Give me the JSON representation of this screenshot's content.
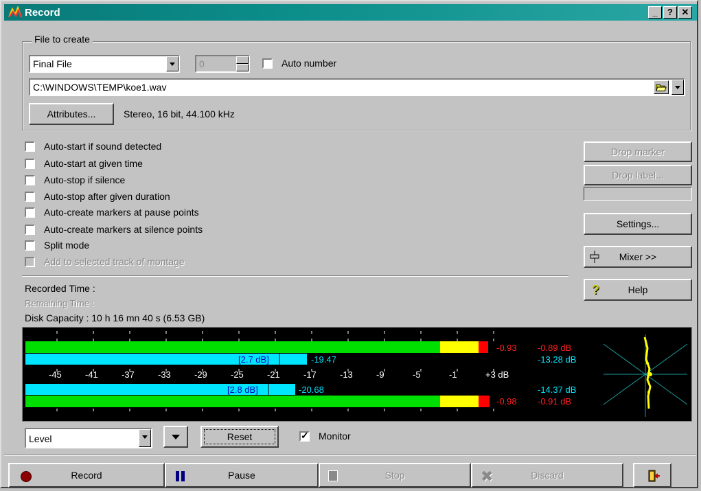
{
  "window": {
    "title": "Record",
    "buttons": {
      "minimize": "_",
      "help": "?",
      "close": "✕"
    }
  },
  "file_group": {
    "legend": "File to create",
    "type_value": "Final File",
    "number_value": "0",
    "auto_number_label": "Auto number",
    "path": "C:\\WINDOWS\\TEMP\\koe1.wav",
    "attributes_button": "Attributes...",
    "format": "Stereo, 16 bit, 44.100 kHz"
  },
  "options": [
    {
      "label": "Auto-start if sound detected",
      "checked": false,
      "enabled": true
    },
    {
      "label": "Auto-start at given time",
      "checked": false,
      "enabled": true
    },
    {
      "label": "Auto-stop if silence",
      "checked": false,
      "enabled": true
    },
    {
      "label": "Auto-stop after given duration",
      "checked": false,
      "enabled": true
    },
    {
      "label": "Auto-create markers at pause points",
      "checked": false,
      "enabled": true
    },
    {
      "label": "Auto-create markers at silence points",
      "checked": false,
      "enabled": true
    },
    {
      "label": "Split mode",
      "checked": false,
      "enabled": true
    },
    {
      "label": "Add to selected track of montage",
      "checked": false,
      "enabled": false
    }
  ],
  "side_buttons": {
    "drop_marker": "Drop marker",
    "drop_label": "Drop label...",
    "settings": "Settings...",
    "mixer": "Mixer >>",
    "help": "Help"
  },
  "status": {
    "recorded_time": "Recorded Time :",
    "remaining_time": "Remaining Time :",
    "disk_capacity": "Disk Capacity : 10 h 16 mn 40 s (6.53 GB)"
  },
  "meter": {
    "scale": [
      "-45",
      "-41",
      "-37",
      "-33",
      "-29",
      "-25",
      "-21",
      "-17",
      "-13",
      "-9",
      "-5",
      "-1",
      "+3 dB"
    ],
    "level_top": {
      "peak": "-0.93",
      "max": "-0.89 dB",
      "value": -0.93
    },
    "rms_top": {
      "tag": "[2.7 dB]",
      "value_label": "-19.47",
      "max": "-13.28 dB",
      "value": -19.47
    },
    "rms_bottom": {
      "tag": "[2.8 dB]",
      "value_label": "-20.68",
      "max": "-14.37 dB",
      "value": -20.68
    },
    "level_bottom": {
      "peak": "-0.98",
      "max": "-0.91 dB",
      "value": -0.98
    }
  },
  "controls": {
    "mode_value": "Level",
    "reset": "Reset",
    "monitor_label": "Monitor",
    "monitor_checked": true
  },
  "transport": {
    "record": "Record",
    "pause": "Pause",
    "stop": "Stop",
    "discard": "Discard"
  },
  "colors": {
    "green": "#00e000",
    "yellow": "#ffff00",
    "red": "#ff0000",
    "cyan": "#00e5ff",
    "record": "#8b0000",
    "pause": "#000080"
  }
}
